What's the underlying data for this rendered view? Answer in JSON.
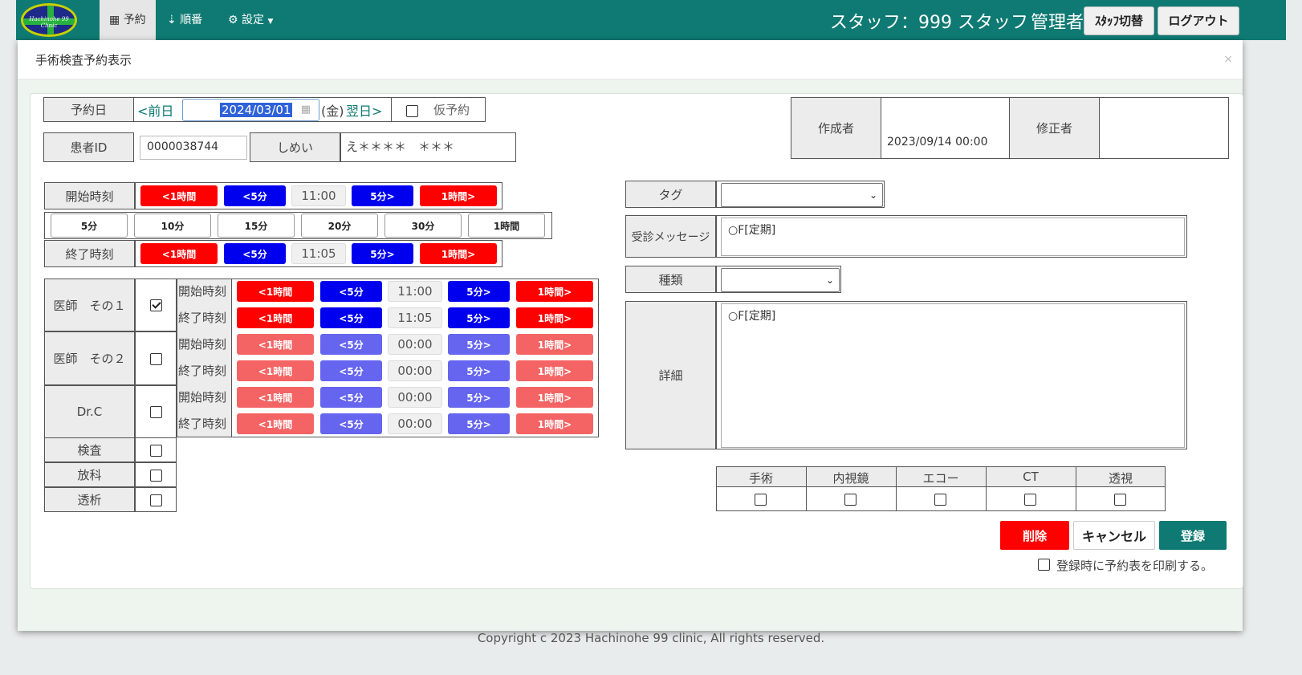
{
  "nav": {
    "logo_text": "Hachinohe 99 Clinic",
    "items": [
      {
        "icon": "calendar-icon",
        "label": "予約"
      },
      {
        "icon": "sort-icon",
        "label": "順番"
      },
      {
        "icon": "gear-icon",
        "label": "設定",
        "caret": "▼"
      }
    ],
    "staff_text": "スタッフ：999 スタッフ",
    "role_text": "管理者",
    "switch_button": "ｽﾀｯﾌ切替",
    "logout_button": "ログアウト"
  },
  "modal": {
    "title": "手術検査予約表示",
    "close": "×"
  },
  "form": {
    "date_label": "予約日",
    "prev_day": "<前日",
    "date_value": "2024/03/01",
    "weekday": "(金)",
    "next_day": "翌日>",
    "provisional_label": "仮予約",
    "patient_id_label": "患者ID",
    "patient_id_value": "0000038744",
    "name_label": "しめい",
    "name_value": "え＊＊＊＊　＊＊＊",
    "creator_label": "作成者",
    "creator_value": "2023/09/14 00:00",
    "editor_label": "修正者",
    "editor_value": "",
    "start_label": "開始時刻",
    "end_label": "終了時刻",
    "start_time": "11:00",
    "end_time": "11:05",
    "btn_minus_hour": "<1時間",
    "btn_minus_5": "<5分",
    "btn_plus_5": "5分>",
    "btn_plus_hour": "1時間>",
    "durations": [
      "5分",
      "10分",
      "15分",
      "20分",
      "30分",
      "1時間"
    ],
    "doctors": [
      {
        "name": "医師　その１",
        "checked": true,
        "start": "11:00",
        "end": "11:05"
      },
      {
        "name": "医師　その２",
        "checked": false,
        "start": "00:00",
        "end": "00:00"
      },
      {
        "name": "Dr.C",
        "checked": false,
        "start": "00:00",
        "end": "00:00"
      }
    ],
    "row_start": "開始時刻",
    "row_end": "終了時刻",
    "extras": [
      {
        "name": "検査",
        "checked": false
      },
      {
        "name": "放科",
        "checked": false
      },
      {
        "name": "透析",
        "checked": false
      }
    ],
    "tag_label": "タグ",
    "tag_value": "",
    "message_label": "受診メッセージ",
    "message_value": "○F[定期]",
    "kind_label": "種類",
    "kind_value": "",
    "detail_label": "詳細",
    "detail_value": "○F[定期]",
    "categories": [
      "手術",
      "内視鏡",
      "エコー",
      "CT",
      "透視"
    ],
    "delete_button": "削除",
    "cancel_button": "キャンセル",
    "register_button": "登録",
    "print_label": "登録時に予約表を印刷する。"
  },
  "footer": {
    "copyright": "Copyright c 2023 Hachinohe 99 clinic, All rights reserved."
  },
  "colors": {
    "navbar": "#0e7a73",
    "red": "#ff0000",
    "blue": "#0000ee",
    "light_red": "#f56464",
    "light_blue": "#6565f0",
    "register": "#0e7a73"
  }
}
